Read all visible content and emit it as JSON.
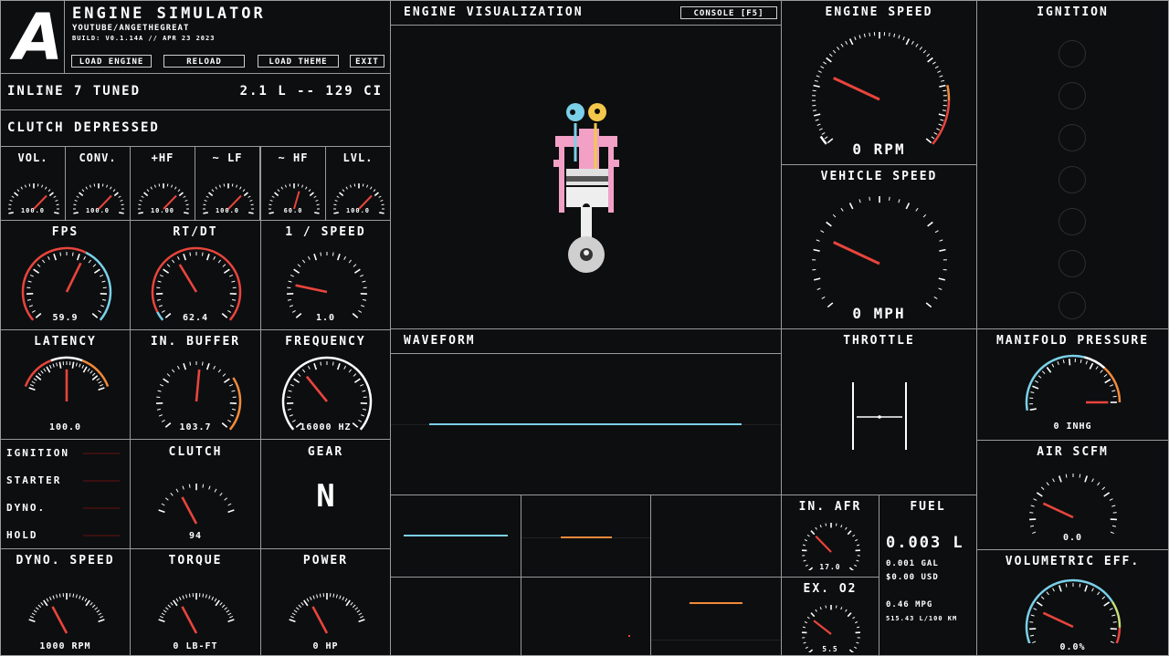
{
  "app": {
    "logo_letter": "A",
    "title": "ENGINE SIMULATOR",
    "subtitle": "YOUTUBE/ANGETHEGREAT",
    "build": "BUILD: V0.1.14A // APR 23 2023",
    "buttons": [
      "LOAD ENGINE",
      "RELOAD",
      "LOAD THEME",
      "EXIT"
    ]
  },
  "engine": {
    "name": "INLINE 7 TUNED",
    "displacement": "2.1 L -- 129 CI"
  },
  "clutch_status": "CLUTCH DEPRESSED",
  "audio_gauges": [
    {
      "label": "VOL.",
      "value": "100.0",
      "frac": 0.72
    },
    {
      "label": "CONV.",
      "value": "100.0",
      "frac": 0.72
    },
    {
      "label": "+HF",
      "value": "10.00",
      "frac": 0.72
    },
    {
      "label": "~ LF",
      "value": "100.0",
      "frac": 0.72
    },
    {
      "label": "~ HF",
      "value": "60.0",
      "frac": 0.58
    },
    {
      "label": "LVL.",
      "value": "100.0",
      "frac": 0.72
    }
  ],
  "perf_gauges": [
    {
      "label": "FPS",
      "value": "59.9",
      "frac": 0.6
    },
    {
      "label": "RT/DT",
      "value": "62.4",
      "frac": 0.38
    },
    {
      "label": "1 / SPEED",
      "value": "1.0",
      "frac": 0.2
    },
    {
      "label": "LATENCY",
      "value": "100.0",
      "frac": 0.5
    },
    {
      "label": "IN. BUFFER",
      "value": "103.7",
      "frac": 0.52
    },
    {
      "label": "FREQUENCY",
      "value": "16000 HZ",
      "frac": 0.35
    }
  ],
  "indicators": [
    "IGNITION",
    "STARTER",
    "DYNO.",
    "HOLD"
  ],
  "clutch": {
    "label": "CLUTCH",
    "value": "94",
    "frac": 0.3
  },
  "gear": {
    "label": "GEAR",
    "value": "N"
  },
  "bottom_gauges": [
    {
      "label": "DYNO. SPEED",
      "value": "1000 RPM",
      "frac": 0.3
    },
    {
      "label": "TORQUE",
      "value": "0 LB-FT",
      "frac": 0.3
    },
    {
      "label": "POWER",
      "value": "0 HP",
      "frac": 0.3
    }
  ],
  "visualization": {
    "title": "ENGINE VISUALIZATION",
    "console_button": "CONSOLE [F5]"
  },
  "waveform": {
    "title": "WAVEFORM"
  },
  "speed": {
    "engine_title": "ENGINE SPEED",
    "engine_value": "0 RPM",
    "vehicle_title": "VEHICLE SPEED",
    "vehicle_value": "0 MPH"
  },
  "ignition": {
    "title": "IGNITION"
  },
  "throttle": {
    "title": "THROTTLE"
  },
  "manifold": {
    "title": "MANIFOLD PRESSURE",
    "value": "0 INHG"
  },
  "air": {
    "title": "AIR SCFM",
    "value": "0.0"
  },
  "afr": {
    "title": "IN. AFR",
    "value": "17.0"
  },
  "o2": {
    "title": "EX. O2",
    "value": "5.5"
  },
  "fuel": {
    "title": "FUEL",
    "liters": "0.003 L",
    "gal": "0.001 GAL",
    "usd": "$0.00 USD",
    "mpg": "0.46 MPG",
    "lkm": "515.43 L/100 KM"
  },
  "ve": {
    "title": "VOLUMETRIC EFF.",
    "value": "0.0%"
  },
  "colors": {
    "red": "#e8453c",
    "blue": "#7ad0e8",
    "orange": "#f08a3a",
    "pink": "#f2a0c6",
    "yellow": "#f4c84a"
  }
}
